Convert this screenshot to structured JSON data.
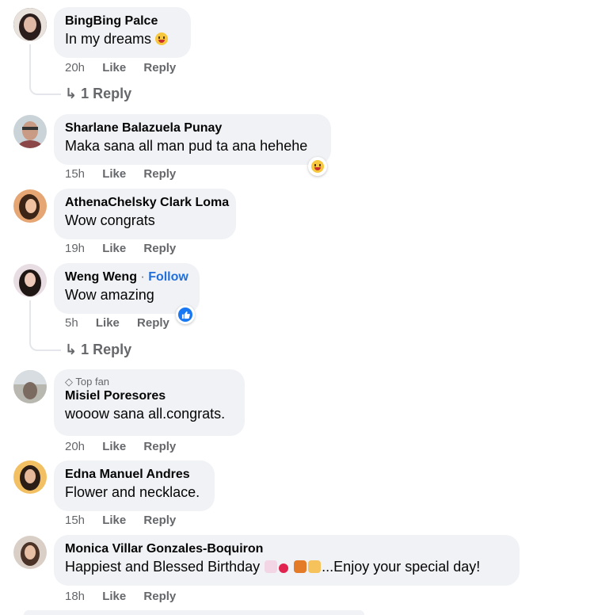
{
  "comments": [
    {
      "name": "BingBing Palce",
      "text": "In my dreams",
      "time": "20h",
      "like": "Like",
      "reply": "Reply",
      "replies": "1 Reply"
    },
    {
      "name": "Sharlane Balazuela Punay",
      "text": "Maka sana all man pud ta ana hehehe",
      "time": "15h",
      "like": "Like",
      "reply": "Reply"
    },
    {
      "name": "AthenaChelsky Clark Loma",
      "text": "Wow congrats",
      "time": "19h",
      "like": "Like",
      "reply": "Reply"
    },
    {
      "name": "Weng Weng",
      "follow": "Follow",
      "text": "Wow amazing",
      "time": "5h",
      "like": "Like",
      "reply": "Reply",
      "replies": "1 Reply"
    },
    {
      "badge": "Top fan",
      "name": "Misiel Poresores",
      "text": "wooow sana all.congrats.",
      "time": "20h",
      "like": "Like",
      "reply": "Reply"
    },
    {
      "name": "Edna Manuel Andres",
      "text": "Flower and necklace.",
      "time": "15h",
      "like": "Like",
      "reply": "Reply"
    },
    {
      "name": "Monica Villar Gonzales-Boquiron",
      "text_start": "Happiest and Blessed Birthday ",
      "text_end": "...Enjoy your special day!",
      "time": "18h",
      "like": "Like",
      "reply": "Reply"
    }
  ],
  "colors": {
    "bubble": "#f0f2f5",
    "meta": "#65676b",
    "follow": "#216fdb",
    "like_blue": "#1877f2"
  }
}
